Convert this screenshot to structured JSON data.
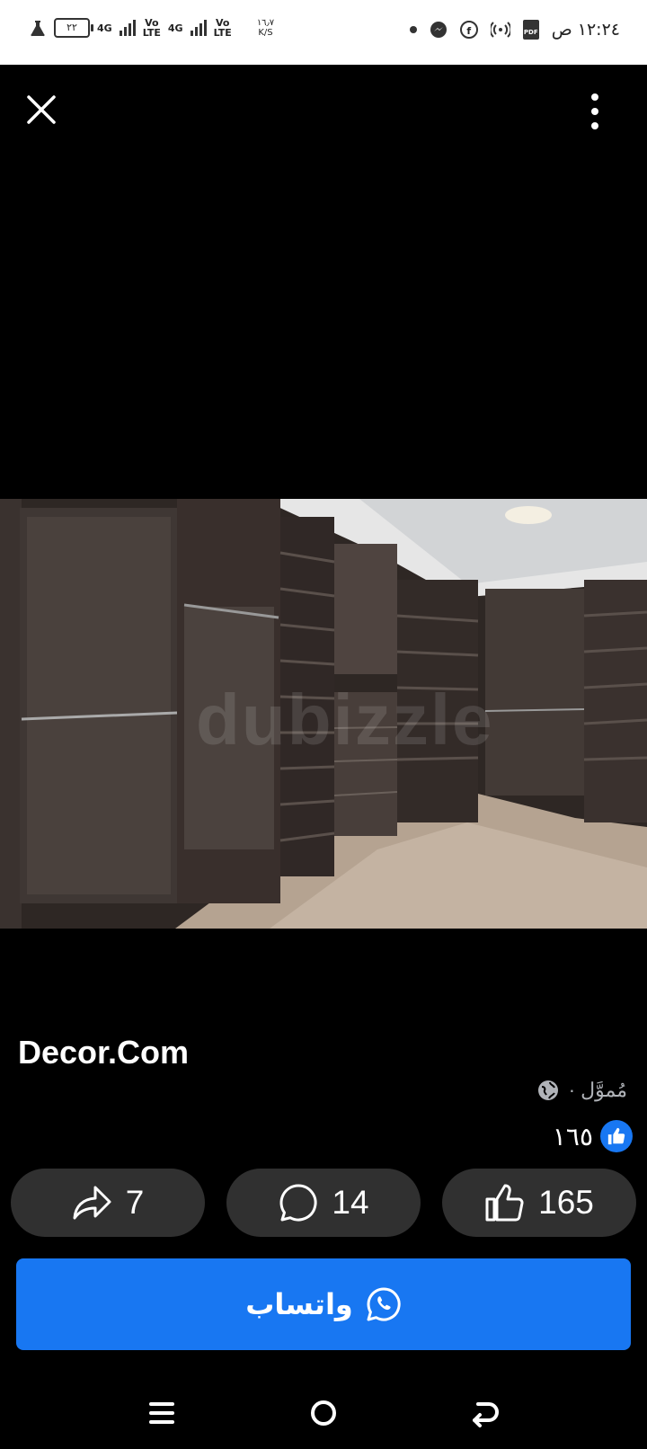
{
  "status_bar": {
    "battery": "٢٢",
    "net1": "4G",
    "volte1_top": "Vo",
    "volte1_bottom": "LTE",
    "net2": "4G",
    "volte2_top": "Vo",
    "volte2_bottom": "LTE",
    "speed_top": "١٦٫٧",
    "speed_bottom": "K/S",
    "pdf_label": "PDF",
    "time": "١٢:٢٤ ص"
  },
  "header": {
    "close_icon": "close-icon",
    "more_icon": "more-vertical-icon"
  },
  "photo": {
    "description_icon": "walk-in-closet-photo",
    "watermark": "dubizzle"
  },
  "post": {
    "title": "Decor.Com",
    "sponsored_label": "مُموَّل ·",
    "likes_count_ar": "١٦٥"
  },
  "actions": {
    "share_count": "7",
    "comment_count": "14",
    "like_count": "165"
  },
  "cta": {
    "label": "واتساب"
  },
  "colors": {
    "accent": "#1877f2",
    "button_bg": "#303030",
    "background": "#000000"
  }
}
